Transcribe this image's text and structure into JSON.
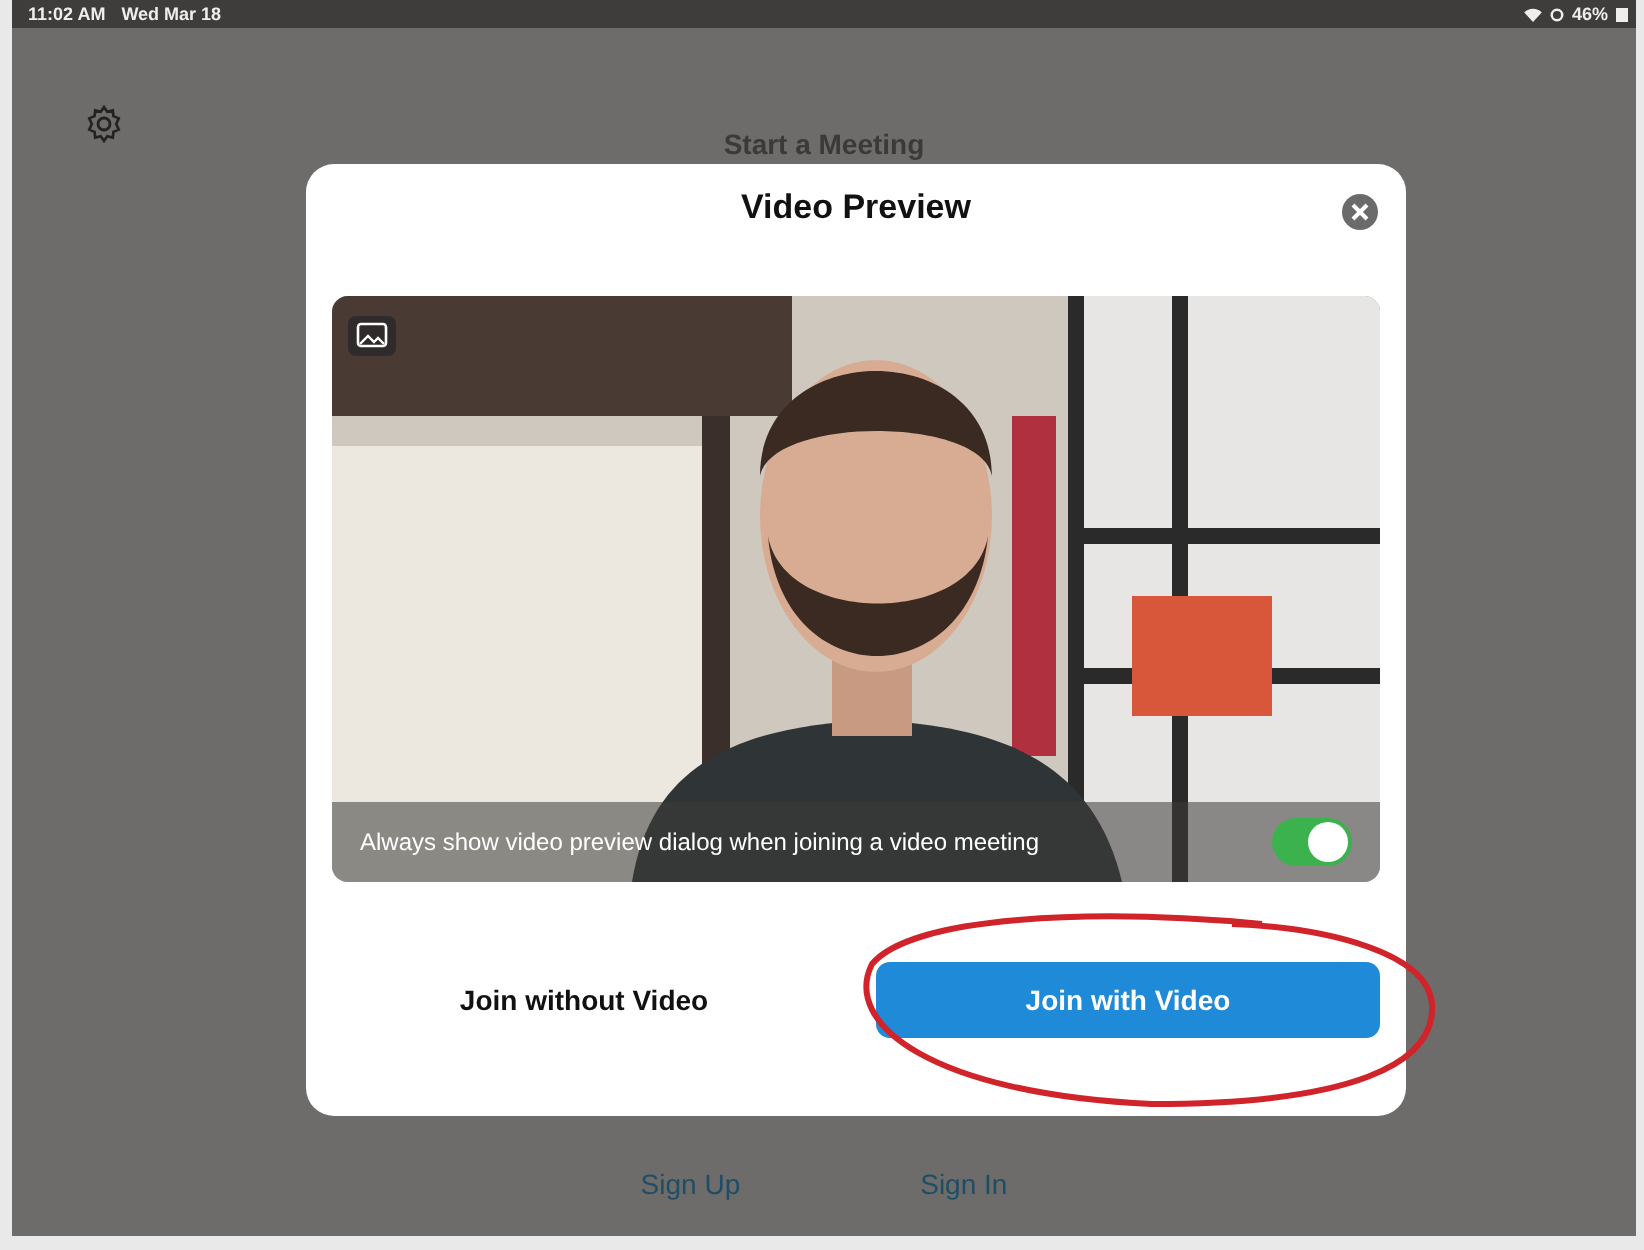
{
  "status_bar": {
    "time": "11:02 AM",
    "date": "Wed Mar 18",
    "battery": "46%"
  },
  "background_title": "Start a Meeting",
  "dialog": {
    "title": "Video Preview",
    "toggle": {
      "label": "Always show video preview dialog when joining a video meeting",
      "on": true
    },
    "buttons": [
      {
        "label": "Join without Video",
        "kind": "plain"
      },
      {
        "label": "Join with Video",
        "kind": "primary"
      }
    ]
  },
  "footer_links": [
    "Sign Up",
    "Sign In"
  ]
}
